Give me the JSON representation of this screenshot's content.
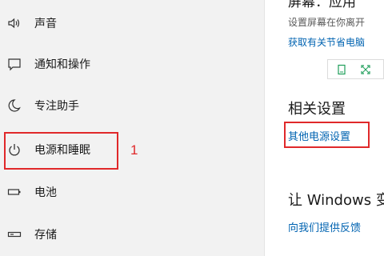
{
  "sidebar": {
    "items": [
      {
        "label": "声音",
        "icon": "speaker-icon"
      },
      {
        "label": "通知和操作",
        "icon": "notification-icon"
      },
      {
        "label": "专注助手",
        "icon": "moon-icon"
      },
      {
        "label": "电源和睡眠",
        "icon": "power-icon"
      },
      {
        "label": "电池",
        "icon": "battery-icon"
      },
      {
        "label": "存储",
        "icon": "storage-icon"
      }
    ],
    "selected": "电源和睡眠"
  },
  "annotation": {
    "number": "1"
  },
  "main": {
    "top_heading_partial": "屏幕：应用",
    "description": "设置屏幕在你离开",
    "power_link": "获取有关节省电脑",
    "related": {
      "title": "相关设置",
      "link": "其他电源设置"
    },
    "feedback": {
      "title": "让 Windows 变",
      "link": "向我们提供反馈"
    }
  },
  "colors": {
    "sidebar_bg": "#f2f2f2",
    "link": "#0063b1",
    "highlight_red": "#e0282a",
    "icon_green": "#1e9e5a"
  }
}
